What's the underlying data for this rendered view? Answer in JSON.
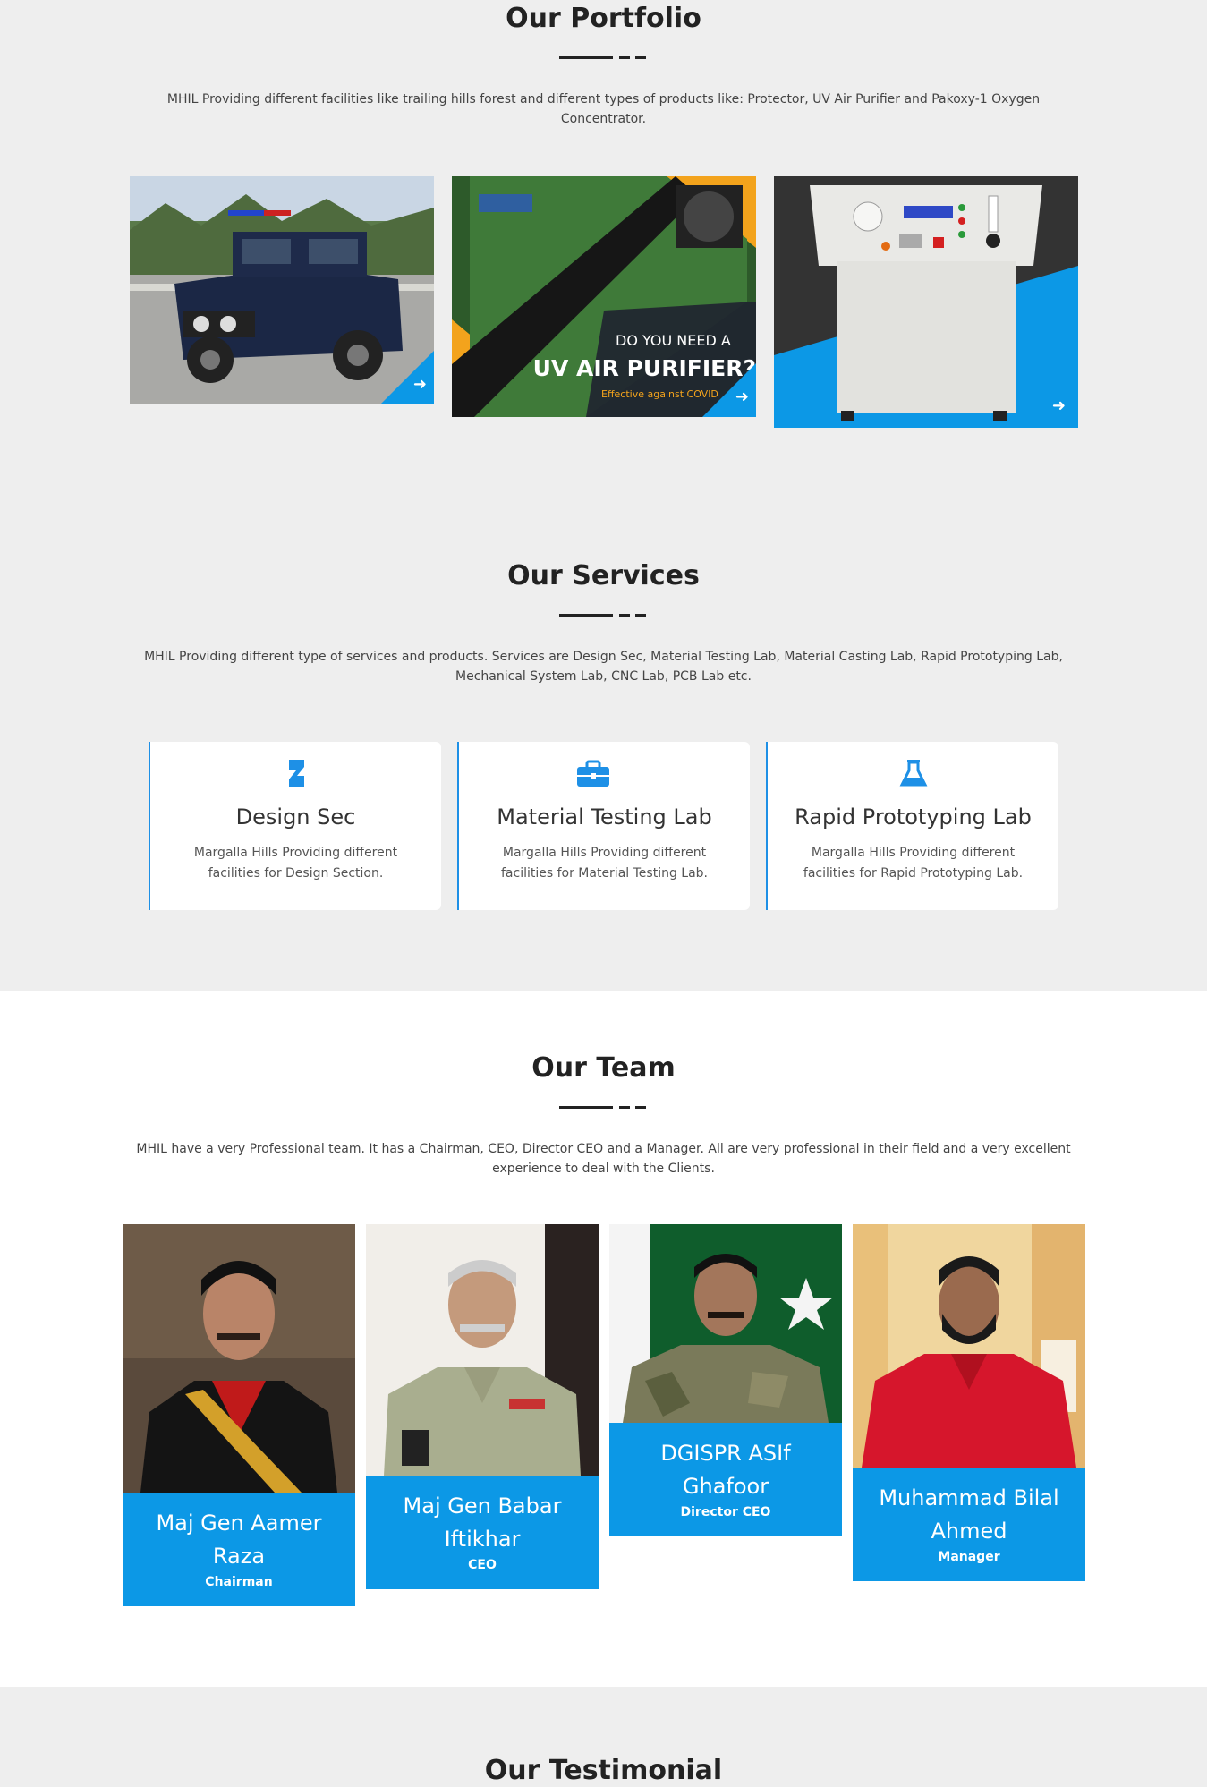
{
  "portfolio": {
    "heading": "Our Portfolio",
    "intro": "MHIL Providing different facilities like trailing hills forest and different types of products like: Protector, UV Air Purifier and Pakoxy-1 Oxygen Concentrator.",
    "items": [
      {
        "alt": "Protector armored vehicle"
      },
      {
        "headline_small": "DO YOU NEED A",
        "headline_big": "UV AIR PURIFIER?",
        "tagline": "Effective against COVID"
      },
      {
        "alt": "Pakoxy-1 Oxygen Concentrator"
      }
    ]
  },
  "services": {
    "heading": "Our Services",
    "intro": "MHIL Providing different type of services and products. Services are Design Sec, Material Testing Lab, Material Casting Lab, Rapid Prototyping Lab, Mechanical System Lab, CNC Lab, PCB Lab etc.",
    "cards": [
      {
        "icon": "deviantart-icon",
        "title": "Design Sec",
        "desc": "Margalla Hills Providing different facilities for Design Section."
      },
      {
        "icon": "briefcase-icon",
        "title": "Material Testing Lab",
        "desc": "Margalla Hills Providing different facilities for Material Testing Lab."
      },
      {
        "icon": "flask-icon",
        "title": "Rapid Prototyping Lab",
        "desc": "Margalla Hills Providing different facilities for Rapid Prototyping Lab."
      }
    ]
  },
  "team": {
    "heading": "Our Team",
    "intro": "MHIL have a very Professional team. It has a Chairman, CEO, Director CEO and a Manager. All are very professional in their field and a very excellent experience to deal with the Clients.",
    "members": [
      {
        "name": "Maj Gen Aamer Raza",
        "role": "Chairman"
      },
      {
        "name": "Maj Gen Babar Iftikhar",
        "role": "CEO"
      },
      {
        "name": "DGISPR ASIf Ghafoor",
        "role": "Director CEO"
      },
      {
        "name": "Muhammad Bilal Ahmed",
        "role": "Manager"
      }
    ]
  },
  "testimonial": {
    "heading": "Our Testimonial"
  },
  "colors": {
    "accent": "#0c98e6",
    "page_bg": "#eeeeee",
    "team_bg": "#ffffff"
  }
}
